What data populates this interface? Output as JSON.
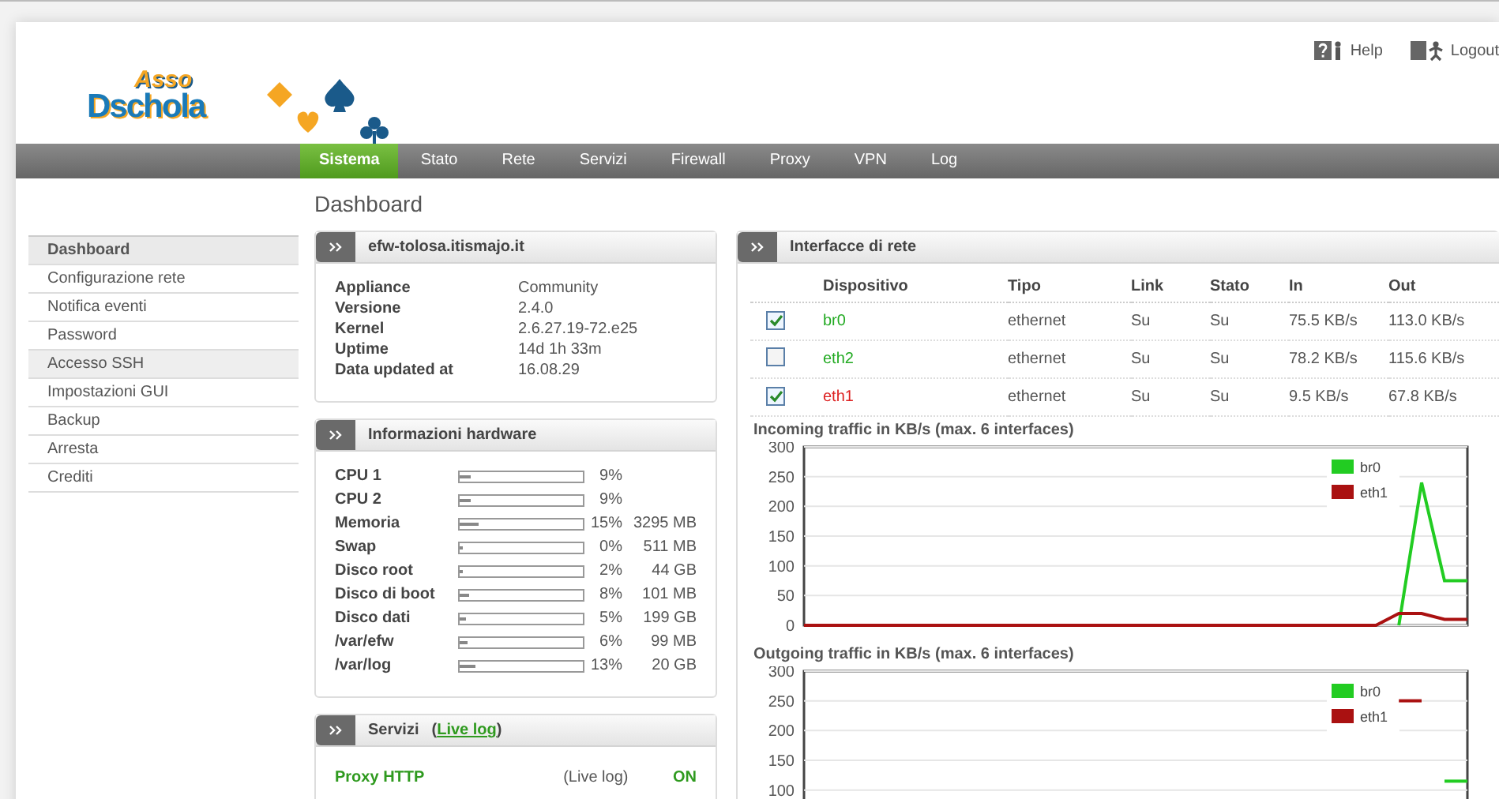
{
  "logo": {
    "line_1": "Asso",
    "line_2": "Dschola"
  },
  "top_links": [
    {
      "kind": "help",
      "label": "Help"
    },
    {
      "kind": "logout",
      "label": "Logout"
    }
  ],
  "nav": [
    {
      "label": "Sistema",
      "selected": true
    },
    {
      "label": "Stato",
      "selected": false
    },
    {
      "label": "Rete",
      "selected": false
    },
    {
      "label": "Servizi",
      "selected": false
    },
    {
      "label": "Firewall",
      "selected": false
    },
    {
      "label": "Proxy",
      "selected": false
    },
    {
      "label": "VPN",
      "selected": false
    },
    {
      "label": "Log",
      "selected": false
    }
  ],
  "page_title": "Dashboard",
  "sidebar": [
    {
      "label": "Dashboard",
      "selected": true
    },
    {
      "label": "Configurazione rete",
      "selected": false
    },
    {
      "label": "Notifica eventi",
      "selected": false
    },
    {
      "label": "Password",
      "selected": false
    },
    {
      "label": "Accesso SSH",
      "selected": false
    },
    {
      "label": "Impostazioni GUI",
      "selected": false
    },
    {
      "label": "Backup",
      "selected": false
    },
    {
      "label": "Arresta",
      "selected": false
    },
    {
      "label": "Crediti",
      "selected": false
    }
  ],
  "host_panel": {
    "title": "efw-tolosa.itismajo.it",
    "rows": [
      {
        "label": "Appliance",
        "value": "Community"
      },
      {
        "label": "Versione",
        "value": "2.4.0"
      },
      {
        "label": "Kernel",
        "value": "2.6.27.19-72.e25"
      },
      {
        "label": "Uptime",
        "value": "14d 1h 33m"
      },
      {
        "label": "Data updated at",
        "value": "16.08.29"
      }
    ]
  },
  "hardware_panel": {
    "title": "Informazioni hardware",
    "rows": [
      {
        "label": "CPU 1",
        "level": 0.09,
        "percent": "9%"
      },
      {
        "label": "CPU 2",
        "level": 0.09,
        "percent": "9%"
      },
      {
        "label": "Memoria",
        "level": 0.15,
        "percent": "15%",
        "size": "3295 MB"
      },
      {
        "label": "Swap",
        "level": 0.0,
        "percent": "0%",
        "size": "511 MB"
      },
      {
        "label": "Disco root",
        "level": 0.02,
        "percent": "2%",
        "size": "44 GB"
      },
      {
        "label": "Disco di boot",
        "level": 0.08,
        "percent": "8%",
        "size": "101 MB"
      },
      {
        "label": "Disco dati",
        "level": 0.05,
        "percent": "5%",
        "size": "199 GB"
      },
      {
        "label": "/var/efw",
        "level": 0.06,
        "percent": "6%",
        "size": "99 MB"
      },
      {
        "label": "/var/log",
        "level": 0.13,
        "percent": "13%",
        "size": "20 GB"
      }
    ]
  },
  "services_panel": {
    "title": "Servizi",
    "link_open": "(",
    "title_link": "Live log",
    "link_close": ")",
    "rows": [
      {
        "name": "Proxy HTTP",
        "link": "(Live log)",
        "status": "ON"
      }
    ]
  },
  "interfaces_panel": {
    "title": "Interfacce di rete",
    "columns": [
      "Dispositivo",
      "Tipo",
      "Link",
      "Stato",
      "In",
      "Out"
    ],
    "rows": [
      {
        "checked": true,
        "device": "br0",
        "color": "#22aa22",
        "type": "ethernet",
        "link": "Su",
        "state": "Su",
        "in": "75.5 KB/s",
        "out": "113.0 KB/s"
      },
      {
        "checked": false,
        "device": "eth2",
        "color": "#22aa22",
        "type": "ethernet",
        "link": "Su",
        "state": "Su",
        "in": "78.2 KB/s",
        "out": "115.6 KB/s"
      },
      {
        "checked": true,
        "device": "eth1",
        "color": "#dd2222",
        "type": "ethernet",
        "link": "Su",
        "state": "Su",
        "in": "9.5 KB/s",
        "out": "67.8 KB/s"
      }
    ],
    "charts": [
      {
        "chart_data": {
          "type": "line",
          "title": "Incoming traffic in KB/s (max. 6 interfaces)",
          "ylim": [
            0,
            300
          ],
          "yticks": [
            0,
            50,
            100,
            150,
            200,
            250,
            300
          ],
          "grid": true,
          "legend": true,
          "series": [
            {
              "name": "br0",
              "color": "#22cc22",
              "values": [
                null,
                null,
                null,
                null,
                null,
                null,
                null,
                null,
                null,
                null,
                null,
                null,
                null,
                null,
                null,
                null,
                null,
                null,
                null,
                null,
                null,
                null,
                null,
                null,
                null,
                null,
                0,
                240,
                75,
                75
              ]
            },
            {
              "name": "eth1",
              "color": "#aa1111",
              "values": [
                0,
                0,
                0,
                0,
                0,
                0,
                0,
                0,
                0,
                0,
                0,
                0,
                0,
                0,
                0,
                0,
                0,
                0,
                0,
                0,
                0,
                0,
                0,
                0,
                0,
                0,
                20,
                20,
                10,
                10
              ]
            }
          ]
        }
      },
      {
        "chart_data": {
          "type": "line",
          "title": "Outgoing traffic in KB/s (max. 6 interfaces)",
          "ylim": [
            0,
            300
          ],
          "yticks": [
            100,
            150,
            200,
            250,
            300
          ],
          "grid": true,
          "legend": true,
          "series": [
            {
              "name": "br0",
              "color": "#22cc22",
              "values": [
                null,
                null,
                null,
                null,
                null,
                null,
                null,
                null,
                null,
                null,
                null,
                null,
                null,
                null,
                null,
                null,
                null,
                null,
                null,
                null,
                null,
                null,
                null,
                null,
                null,
                null,
                null,
                null,
                115,
                115
              ]
            },
            {
              "name": "eth1",
              "color": "#aa1111",
              "values": [
                null,
                null,
                null,
                null,
                null,
                null,
                null,
                null,
                null,
                null,
                null,
                null,
                null,
                null,
                null,
                null,
                null,
                null,
                null,
                null,
                null,
                null,
                null,
                null,
                null,
                null,
                250,
                250,
                null,
                null
              ]
            }
          ]
        }
      }
    ]
  }
}
